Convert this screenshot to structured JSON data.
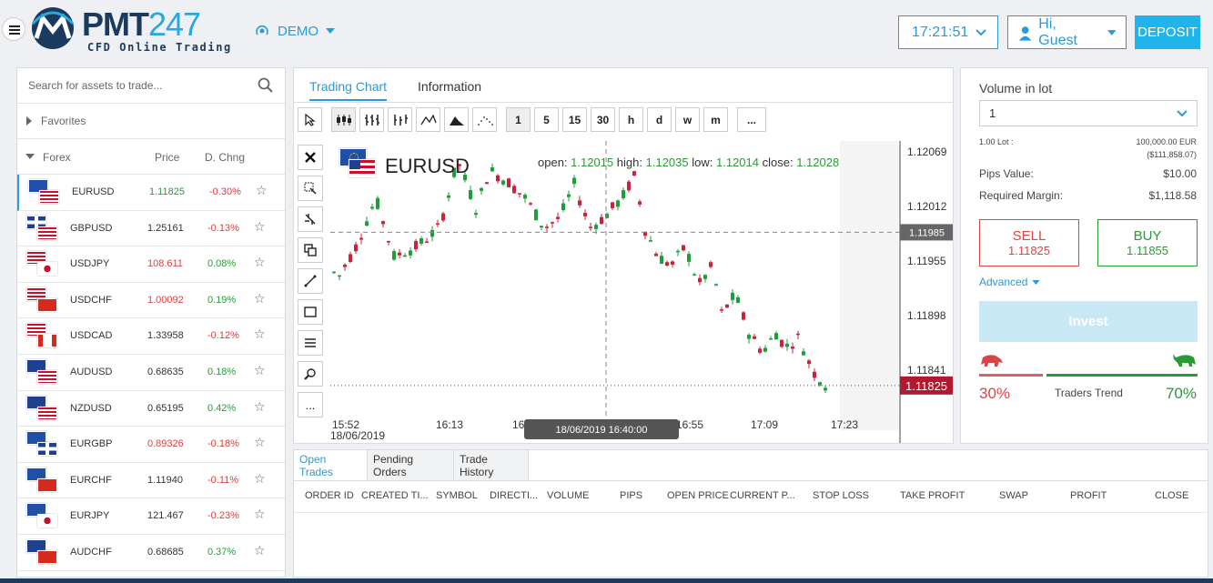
{
  "header": {
    "brand": "PMT",
    "brand_num": "247",
    "brand_sub": "CFD Online Trading",
    "mode": "DEMO",
    "time": "17:21:51",
    "user": "Hi, Guest",
    "deposit": "DEPOSIT"
  },
  "sidebar": {
    "search_placeholder": "Search for assets to trade...",
    "favorites": "Favorites",
    "forex": "Forex",
    "col_price": "Price",
    "col_change": "D. Chng",
    "rows": [
      {
        "symbol": "EURUSD",
        "price": "1.11825",
        "change": "-0.30%"
      },
      {
        "symbol": "GBPUSD",
        "price": "1.25161",
        "change": "-0.13%"
      },
      {
        "symbol": "USDJPY",
        "price": "108.611",
        "change": "0.08%"
      },
      {
        "symbol": "USDCHF",
        "price": "1.00092",
        "change": "0.19%"
      },
      {
        "symbol": "USDCAD",
        "price": "1.33958",
        "change": "-0.12%"
      },
      {
        "symbol": "AUDUSD",
        "price": "0.68635",
        "change": "0.18%"
      },
      {
        "symbol": "NZDUSD",
        "price": "0.65195",
        "change": "0.42%"
      },
      {
        "symbol": "EURGBP",
        "price": "0.89326",
        "change": "-0.18%"
      },
      {
        "symbol": "EURCHF",
        "price": "1.11940",
        "change": "-0.11%"
      },
      {
        "symbol": "EURJPY",
        "price": "121.467",
        "change": "-0.23%"
      },
      {
        "symbol": "AUDCHF",
        "price": "0.68685",
        "change": "0.37%"
      }
    ]
  },
  "chart": {
    "tab_chart": "Trading Chart",
    "tab_info": "Information",
    "timeframes": [
      "1",
      "5",
      "15",
      "30",
      "h",
      "d",
      "w",
      "m"
    ],
    "more": "...",
    "pair": "EURUSD",
    "open_label": "open:",
    "open": "1.12015",
    "high_label": "high:",
    "high": "1.12035",
    "low_label": "low:",
    "low": "1.12014",
    "close_label": "close:",
    "close": "1.12028",
    "y_ticks": [
      "1.12069",
      "1.12012",
      "1.11955",
      "1.11898",
      "1.11841"
    ],
    "crosshair_price": "1.11985",
    "last_price": "1.11825",
    "x_ticks": [
      "15:52",
      "16:13",
      "16:34",
      "16:55",
      "17:09",
      "17:23"
    ],
    "x_date": "18/06/2019",
    "crosshair_time": "18/06/2019 16:40:00"
  },
  "order": {
    "volume_label": "Volume in lot",
    "volume_value": "1",
    "lot_label": "1.00 Lot :",
    "lot_value": "100,000.00 EUR",
    "lot_usd": "($111,858.07)",
    "pips_label": "Pips Value:",
    "pips_value": "$10.00",
    "margin_label": "Required Margin:",
    "margin_value": "$1,118.58",
    "sell_label": "SELL",
    "sell_price": "1.11825",
    "buy_label": "BUY",
    "buy_price": "1.11855",
    "advanced": "Advanced",
    "invest": "Invest",
    "bear_pct": "30%",
    "trend_label": "Traders Trend",
    "bull_pct": "70%",
    "bull_fraction": 0.7
  },
  "trades": {
    "tabs": [
      "Open Trades",
      "Pending Orders",
      "Trade History"
    ],
    "columns": [
      "ORDER ID",
      "CREATED TI...",
      "SYMBOL",
      "DIRECTI...",
      "VOLUME",
      "PIPS",
      "OPEN PRICE",
      "CURRENT P...",
      "STOP LOSS",
      "TAKE PROFIT",
      "SWAP",
      "PROFIT",
      "CLOSE"
    ]
  },
  "colors": {
    "accent": "#2a9ad8",
    "up": "#2a9a36",
    "down": "#d94545",
    "deposit": "#20b5ea"
  }
}
